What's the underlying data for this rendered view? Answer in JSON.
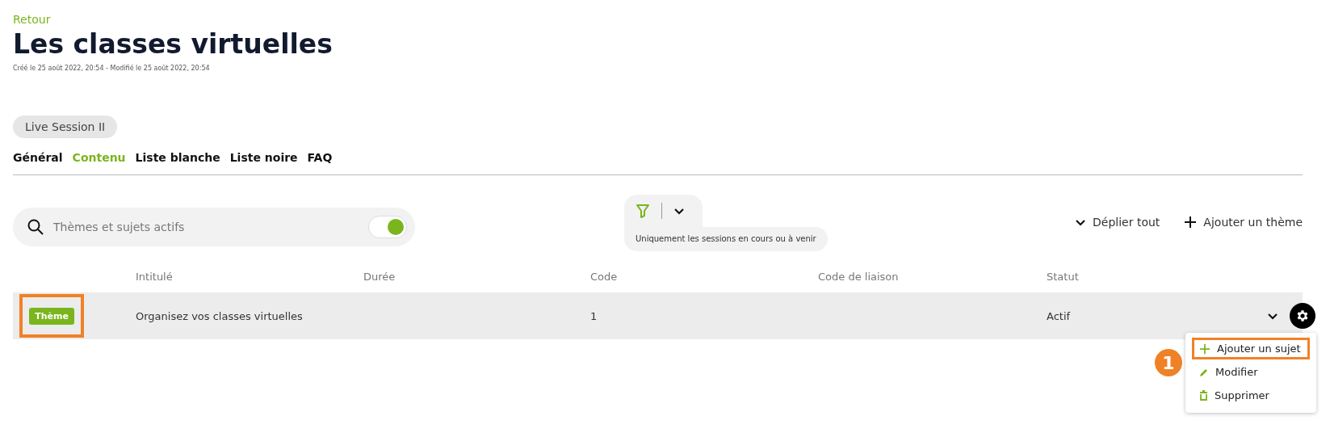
{
  "back_link": "Retour",
  "title": "Les classes virtuelles",
  "meta": "Créé le 25 août 2022, 20:54 - Modifié le 25 août 2022, 20:54",
  "session_chip": "Live Session II",
  "tabs": [
    {
      "label": "Général",
      "selected": false
    },
    {
      "label": "Contenu",
      "selected": true
    },
    {
      "label": "Liste blanche",
      "selected": false
    },
    {
      "label": "Liste noire",
      "selected": false
    },
    {
      "label": "FAQ",
      "selected": false
    }
  ],
  "search": {
    "placeholder": "Thèmes et sujets actifs",
    "toggle_on": true
  },
  "filter": {
    "caption": "Uniquement les sessions en cours ou à venir"
  },
  "actions": [
    {
      "kind": "expand",
      "label": "Déplier tout"
    },
    {
      "kind": "add",
      "label": "Ajouter un thème"
    }
  ],
  "table": {
    "columns": [
      "Intitulé",
      "Durée",
      "Code",
      "Code de liaison",
      "Statut"
    ],
    "rows": [
      {
        "tag": "Thème",
        "tag_highlighted": true,
        "title": "Organisez vos classes virtuelles",
        "duration": "",
        "code": "1",
        "link_code": "",
        "status": "Actif"
      }
    ]
  },
  "menu": {
    "callout": "1",
    "items": [
      {
        "kind": "add",
        "label": "Ajouter un sujet",
        "highlighted": true
      },
      {
        "kind": "edit",
        "label": "Modifier",
        "highlighted": false
      },
      {
        "kind": "delete",
        "label": "Supprimer",
        "highlighted": false
      }
    ]
  }
}
